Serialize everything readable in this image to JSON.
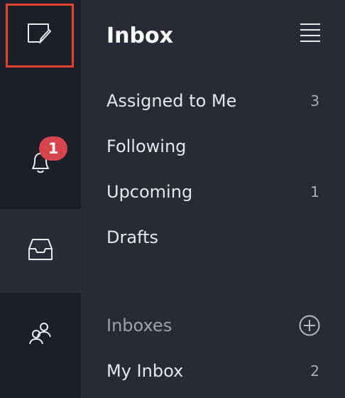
{
  "rail": {
    "items": [
      {
        "icon": "compose-icon"
      },
      {
        "icon": "bell-icon",
        "badge": "1"
      },
      {
        "icon": "inbox-tray-icon"
      },
      {
        "icon": "people-icon"
      }
    ],
    "highlight_color": "#e0432b",
    "badge_color": "#d6454c"
  },
  "header": {
    "title": "Inbox",
    "menu_icon": "hamburger-icon"
  },
  "nav": [
    {
      "label": "Assigned to Me",
      "count": "3"
    },
    {
      "label": "Following",
      "count": ""
    },
    {
      "label": "Upcoming",
      "count": "1"
    },
    {
      "label": "Drafts",
      "count": ""
    }
  ],
  "inboxes": {
    "label": "Inboxes",
    "add_icon": "plus-circle-icon",
    "items": [
      {
        "label": "My Inbox",
        "count": "2"
      }
    ]
  }
}
